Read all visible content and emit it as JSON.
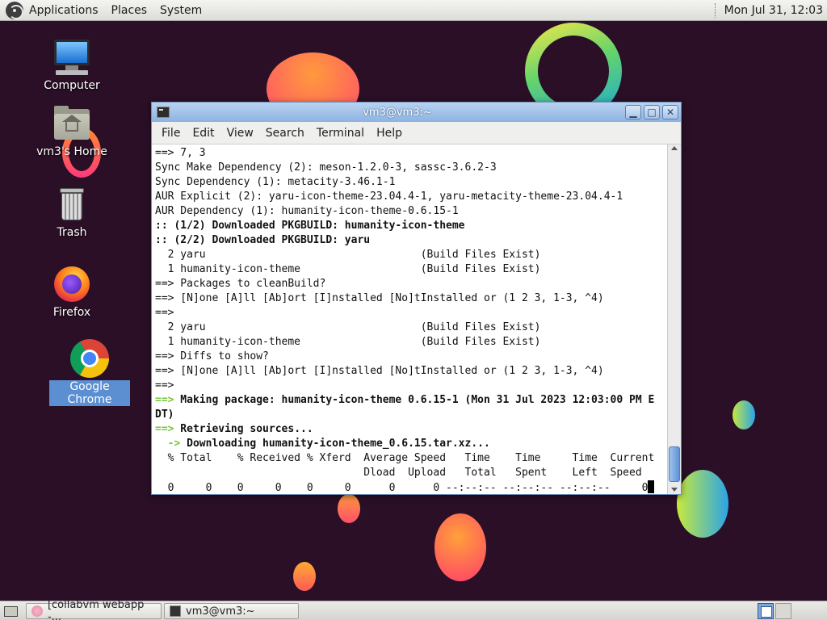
{
  "top_panel": {
    "menus": [
      "Applications",
      "Places",
      "System"
    ],
    "clock": "Mon Jul 31, 12:03"
  },
  "desktop": {
    "icons": [
      {
        "label": "Computer",
        "icon": "computer-icon"
      },
      {
        "label": "vm3's Home",
        "icon": "home-folder-icon"
      },
      {
        "label": "Trash",
        "icon": "trash-icon"
      },
      {
        "label": "Firefox",
        "icon": "firefox-icon"
      },
      {
        "label": "Google Chrome",
        "icon": "chrome-icon",
        "selected": true
      }
    ]
  },
  "terminal": {
    "title": "vm3@vm3:~",
    "window_buttons": [
      "minimize",
      "maximize",
      "close"
    ],
    "menu": [
      "File",
      "Edit",
      "View",
      "Search",
      "Terminal",
      "Help"
    ],
    "lines": [
      {
        "text": "==> 7, 3"
      },
      {
        "text": "Sync Make Dependency (2): meson-1.2.0-3, sassc-3.6.2-3"
      },
      {
        "text": "Sync Dependency (1): metacity-3.46.1-1"
      },
      {
        "text": "AUR Explicit (2): yaru-icon-theme-23.04.4-1, yaru-metacity-theme-23.04.4-1"
      },
      {
        "text": "AUR Dependency (1): humanity-icon-theme-0.6.15-1"
      },
      {
        "text": ":: (1/2) Downloaded PKGBUILD: humanity-icon-theme",
        "bold": true
      },
      {
        "text": ":: (2/2) Downloaded PKGBUILD: yaru",
        "bold": true
      },
      {
        "text": "  2 yaru                                  (Build Files Exist)"
      },
      {
        "text": "  1 humanity-icon-theme                   (Build Files Exist)"
      },
      {
        "text": "==> Packages to cleanBuild?"
      },
      {
        "text": "==> [N]one [A]ll [Ab]ort [I]nstalled [No]tInstalled or (1 2 3, 1-3, ^4)"
      },
      {
        "text": "==>"
      },
      {
        "text": "  2 yaru                                  (Build Files Exist)"
      },
      {
        "text": "  1 humanity-icon-theme                   (Build Files Exist)"
      },
      {
        "text": "==> Diffs to show?"
      },
      {
        "text": "==> [N]one [A]ll [Ab]ort [I]nstalled [No]tInstalled or (1 2 3, 1-3, ^4)"
      },
      {
        "text": "==>"
      },
      {
        "prefix": "==>",
        "text": " Making package: humanity-icon-theme 0.6.15-1 (Mon 31 Jul 2023 12:03:00 PM E",
        "bold": true
      },
      {
        "text": "DT)",
        "bold": true
      },
      {
        "prefix": "==>",
        "text": " Retrieving sources...",
        "bold": true
      },
      {
        "prefix": "  ->",
        "text": " Downloading humanity-icon-theme_0.6.15.tar.xz...",
        "bold": true
      },
      {
        "text": "  % Total    % Received % Xferd  Average Speed   Time    Time     Time  Current"
      },
      {
        "text": "                                 Dload  Upload   Total   Spent    Left  Speed"
      },
      {
        "text": "  0     0    0     0    0     0      0      0 --:--:-- --:--:-- --:--:--     0",
        "cursor": true
      }
    ]
  },
  "taskbar": {
    "items": [
      {
        "label": "[collabvm webapp -...",
        "icon": "chrome-tab-icon"
      },
      {
        "label": "vm3@vm3:~",
        "icon": "terminal-icon"
      }
    ],
    "workspaces": 2,
    "active_workspace": 1
  },
  "colors": {
    "desktop_bg": "#2a0f27",
    "prompt_green": "#78c63c",
    "titlebar_blue": "#8db3e2",
    "selection_blue": "#5b8fd1"
  }
}
